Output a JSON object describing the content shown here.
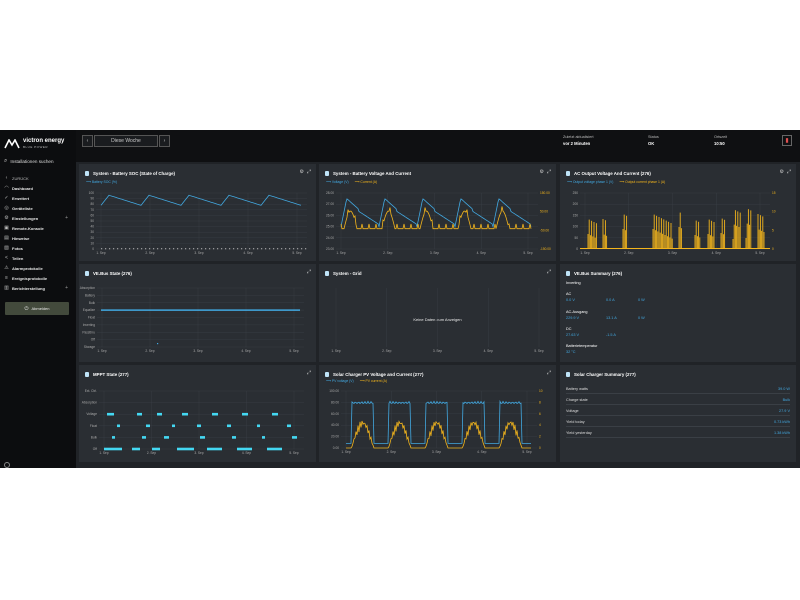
{
  "app": {
    "brand": "victron energy",
    "brand_sub": "BLUE POWER",
    "colors": {
      "accent_blue": "#42a8e0",
      "accent_yellow": "#f3b51c",
      "background": "#202327",
      "panel": "#2a2e33",
      "sidebar": "#0c0d0f"
    }
  },
  "sidebar": {
    "search_label": "Installationen suchen",
    "back_label": "ZURÜCK",
    "items": [
      {
        "label": "Dashboard",
        "icon": "wifi-icon"
      },
      {
        "label": "Erweitert",
        "icon": "chart-icon"
      },
      {
        "label": "Geräteliste",
        "icon": "location-icon"
      },
      {
        "label": "Einstellungen",
        "icon": "gear-icon"
      },
      {
        "label": "Remote-Konsole",
        "icon": "console-icon"
      },
      {
        "label": "Hinweise",
        "icon": "note-icon"
      },
      {
        "label": "Fotos",
        "icon": "photo-icon"
      },
      {
        "label": "Teilen",
        "icon": "share-icon"
      },
      {
        "label": "Alarmprotokolle",
        "icon": "alarm-icon"
      },
      {
        "label": "Ereignisprotokolle",
        "icon": "event-icon"
      },
      {
        "label": "Berichterstellung",
        "icon": "report-icon"
      }
    ],
    "logout_label": "Abmelden"
  },
  "topbar": {
    "range_label": "Diese Woche",
    "last_update_label": "Zuletzt aktualisiert",
    "last_update_value": "vor 2 Minuten",
    "status_label": "Status",
    "status_value": "OK",
    "time_label": "Ortszeit",
    "time_value": "10:50"
  },
  "panels": {
    "soc": {
      "title": "System - Battery SOC (State of Charge)",
      "legend": "Battery SOC (%)",
      "y_ticks": [
        "100",
        "90",
        "80",
        "70",
        "60",
        "50",
        "40",
        "30",
        "20",
        "10",
        "0"
      ],
      "x_ticks": [
        "1. Sep",
        "2. Sep",
        "3. Sep",
        "4. Sep",
        "5. Sep"
      ]
    },
    "bvc": {
      "title": "System - Battery Voltage And Current",
      "legend_voltage": "Voltage (V)",
      "legend_current": "Current (A)",
      "y_left_ticks": [
        "28.00",
        "27.00",
        "26.00",
        "25.00",
        "24.00",
        "23.00"
      ],
      "y_right_ticks": [
        "150.00",
        "50.00",
        "-50.00",
        "-150.00"
      ],
      "x_ticks": [
        "1. Sep",
        "2. Sep",
        "3. Sep",
        "4. Sep",
        "5. Sep"
      ]
    },
    "acout": {
      "title": "AC Output Voltage And Current (276)",
      "legend_voltage": "Output voltage phase 1 (V)",
      "legend_current": "Output current phase 1 (A)",
      "y_left_ticks": [
        "250",
        "200",
        "150",
        "100",
        "50",
        "0"
      ],
      "y_right_ticks": [
        "15",
        "10",
        "5",
        "0"
      ],
      "x_ticks": [
        "1. Sep",
        "2. Sep",
        "3. Sep",
        "4. Sep",
        "5. Sep"
      ]
    },
    "vebus_state": {
      "title": "VE.Bus State (276)",
      "y_ticks": [
        "Absorption",
        "Battery",
        "Bulk",
        "Equalize",
        "Float",
        "Inverting",
        "Passthru",
        "Off",
        "Storage"
      ],
      "x_ticks": [
        "1. Sep",
        "2. Sep",
        "3. Sep",
        "4. Sep",
        "5. Sep"
      ]
    },
    "grid": {
      "title": "System - Grid",
      "no_data": "Keine Daten zum Anzeigen",
      "x_ticks": [
        "1. Sep",
        "2. Sep",
        "3. Sep",
        "4. Sep",
        "5. Sep"
      ]
    },
    "vebus_summary": {
      "title": "VE.Bus Summary (276)",
      "state": "Inverting",
      "ac_label": "AC",
      "ac_in": [
        "0.0 V",
        "0.0 A",
        "0 W"
      ],
      "acout_label": "AC-Ausgang",
      "ac_out": [
        "229.9 V",
        "13.1 A",
        "0 W"
      ],
      "dc_label": "DC",
      "dc": [
        "27.63 V",
        "-1.5 A"
      ],
      "temp_label": "Batterietemperatur",
      "temp_value": "32 °C"
    },
    "mppt": {
      "title": "MPPT State (277)",
      "y_ticks": [
        "Ext. Ctrl.",
        "Absorption",
        "Voltage",
        "Float",
        "Bulk",
        "Off"
      ],
      "x_ticks": [
        "1. Sep",
        "2. Sep",
        "3. Sep",
        "4. Sep",
        "5. Sep"
      ]
    },
    "pv": {
      "title": "Solar Charger PV Voltage and Current (277)",
      "legend_voltage": "PV voltage (V)",
      "legend_current": "PV current (A)",
      "y_left_ticks": [
        "100.00",
        "80.00",
        "60.00",
        "40.00",
        "20.00",
        "0.00"
      ],
      "y_right_ticks": [
        "10",
        "8",
        "6",
        "4",
        "2",
        "0"
      ],
      "x_ticks": [
        "1. Sep",
        "2. Sep",
        "3. Sep",
        "4. Sep",
        "5. Sep"
      ]
    },
    "solar_summary": {
      "title": "Solar Charger Summary (277)",
      "rows": [
        {
          "label": "Battery watts",
          "value": "39.0 W"
        },
        {
          "label": "Charge state",
          "value": "Bulk"
        },
        {
          "label": "Voltage",
          "value": "27.9 V"
        },
        {
          "label": "Yield today",
          "value": "0.73 kWh"
        },
        {
          "label": "Yield yesterday",
          "value": "1.38 kWh"
        }
      ]
    }
  }
}
